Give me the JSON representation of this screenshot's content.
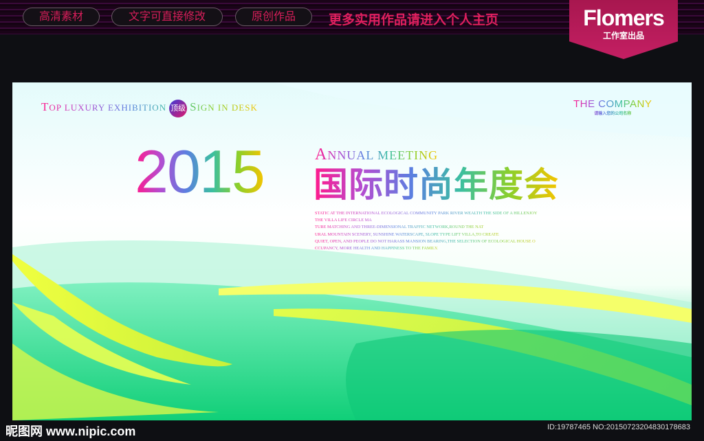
{
  "topbar": {
    "pills": [
      "高清素材",
      "文字可直接修改",
      "原创作品"
    ],
    "promo": "更多实用作品请进入个人主页",
    "brand": {
      "name": "Flomers",
      "sub": "工作室出品"
    }
  },
  "poster": {
    "tagline": {
      "p1_big": "T",
      "p1": "OP LUXURY EXHIBITION",
      "badge": "顶级",
      "p2_big": "S",
      "p2": "IGN IN DESK"
    },
    "company": {
      "name": "THE COMPANY",
      "sub": "请输入您的公司名称"
    },
    "year": "2015",
    "annual": {
      "a_big": "A",
      "a": "NNUAL MEETING"
    },
    "title_cn": "国际时尚年度会",
    "body_lines": [
      "STATIC AT THE INTERNATIONAL ECOLOGICAL COMMUNITY PARK RIVER WEALTH THE SIDE OF A HILLENJOY",
      "THE VILLA LIFE CIRCLE MA",
      "TURE MATCHING AND THREE-DIMENSIONAL TRAFFIC NETWORK,ROUND THE NAT",
      "URAL MOUNTAIN SCENERY, SUNSHINE WATERSCAPE, SLOPE TYPE LIFT VILLA,TO CREATE",
      "QUIET, OPEN, AND PEOPLE DO NOT HARASS MANSION BEARING,THE SELECTION OF ECOLOGICAL HOUSE O",
      "CCUPANCY, MORE HEALTH AND HAPPINESS TO THE FAMILY."
    ]
  },
  "footer": {
    "site": "昵图网 www.nipic.com",
    "id": "ID:19787465 NO:20150723204830178683"
  }
}
